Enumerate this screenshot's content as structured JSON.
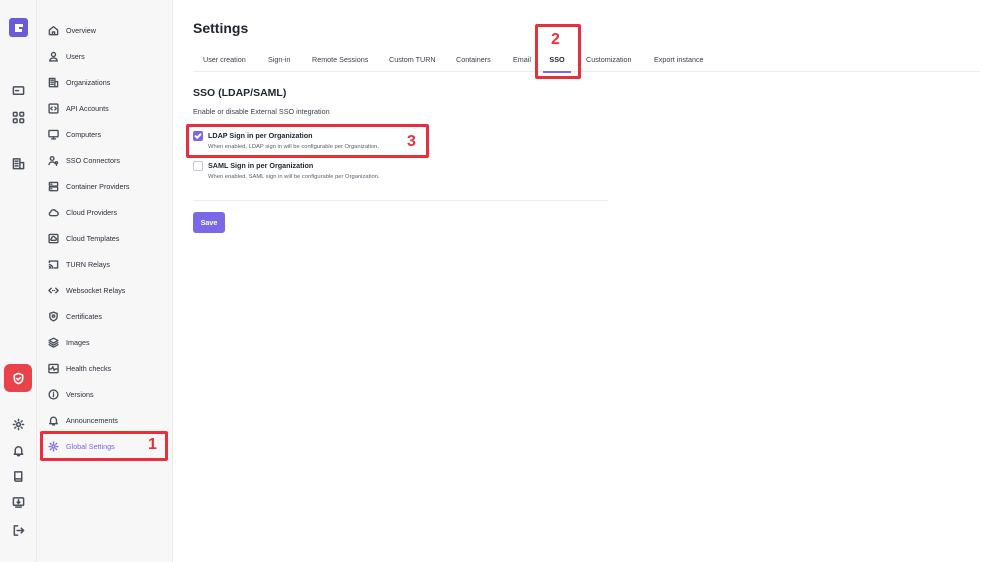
{
  "rail": {
    "items": [
      {
        "icon": "monitor-icon"
      },
      {
        "icon": "grid-icon"
      },
      {
        "icon": "building-icon"
      },
      {
        "icon": "shield-check-icon"
      },
      {
        "icon": "gear-icon"
      },
      {
        "icon": "bell-icon"
      },
      {
        "icon": "book-icon"
      },
      {
        "icon": "inbox-download-icon"
      },
      {
        "icon": "logout-icon"
      }
    ],
    "active_color": "#e8434a"
  },
  "sidebar": {
    "items": [
      {
        "label": "Overview",
        "icon": "home-icon"
      },
      {
        "label": "Users",
        "icon": "user-icon"
      },
      {
        "label": "Organizations",
        "icon": "building-icon"
      },
      {
        "label": "API Accounts",
        "icon": "code-box-icon"
      },
      {
        "label": "Computers",
        "icon": "monitor-icon"
      },
      {
        "label": "SSO Connectors",
        "icon": "users-key-icon"
      },
      {
        "label": "Container Providers",
        "icon": "server-icon"
      },
      {
        "label": "Cloud Providers",
        "icon": "cloud-icon"
      },
      {
        "label": "Cloud Templates",
        "icon": "cloud-template-icon"
      },
      {
        "label": "TURN Relays",
        "icon": "cast-icon"
      },
      {
        "label": "Websocket Relays",
        "icon": "code-arrows-icon"
      },
      {
        "label": "Certificates",
        "icon": "shield-icon"
      },
      {
        "label": "Images",
        "icon": "layers-icon"
      },
      {
        "label": "Health checks",
        "icon": "activity-icon"
      },
      {
        "label": "Versions",
        "icon": "info-icon"
      },
      {
        "label": "Announcements",
        "icon": "bell-icon"
      },
      {
        "label": "Global Settings",
        "icon": "gear-icon"
      }
    ],
    "active_index": 16
  },
  "main": {
    "title": "Settings",
    "tabs": [
      {
        "label": "User creation"
      },
      {
        "label": "Sign-in"
      },
      {
        "label": "Remote Sessions"
      },
      {
        "label": "Custom TURN"
      },
      {
        "label": "Containers"
      },
      {
        "label": "Email"
      },
      {
        "label": "SSO"
      },
      {
        "label": "Customization"
      },
      {
        "label": "Export instance"
      }
    ],
    "active_tab": "SSO",
    "section": {
      "title": "SSO (LDAP/SAML)",
      "description": "Enable or disable External SSO integration",
      "options": [
        {
          "label": "LDAP Sign in per Organization",
          "help": "When enabled, LDAP sign in will be configurable per Organization.",
          "checked": true
        },
        {
          "label": "SAML Sign in per Organization",
          "help": "When enabled, SAML sign in will be configurable per Organization.",
          "checked": false
        }
      ]
    },
    "save_label": "Save"
  },
  "annotations": [
    "1",
    "2",
    "3"
  ],
  "colors": {
    "accent": "#7a68e6",
    "annotation": "#e8303c"
  }
}
